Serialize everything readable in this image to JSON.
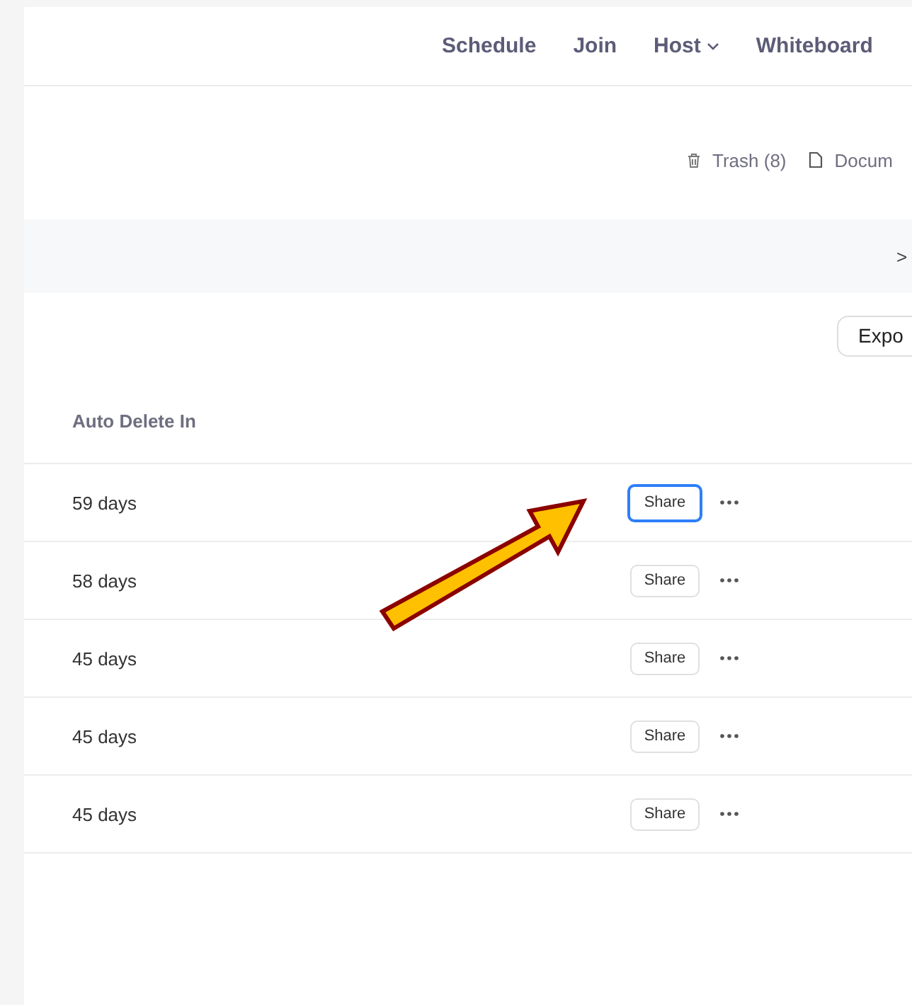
{
  "nav": [
    {
      "label": "Schedule",
      "dropdown": false
    },
    {
      "label": "Join",
      "dropdown": false
    },
    {
      "label": "Host",
      "dropdown": true
    },
    {
      "label": "Whiteboard",
      "dropdown": false
    }
  ],
  "toolbar": [
    {
      "kind": "trash",
      "label": "Trash (8)"
    },
    {
      "kind": "document",
      "label": "Docum"
    }
  ],
  "band": {
    "chevron": ">"
  },
  "export_button": "Expo",
  "table": {
    "columns": [
      "Auto Delete In"
    ],
    "rows": [
      {
        "auto_delete_in": "59 days",
        "share": "Share",
        "focused": true
      },
      {
        "auto_delete_in": "58 days",
        "share": "Share",
        "focused": false
      },
      {
        "auto_delete_in": "45 days",
        "share": "Share",
        "focused": false
      },
      {
        "auto_delete_in": "45 days",
        "share": "Share",
        "focused": false
      },
      {
        "auto_delete_in": "45 days",
        "share": "Share",
        "focused": false
      }
    ]
  }
}
